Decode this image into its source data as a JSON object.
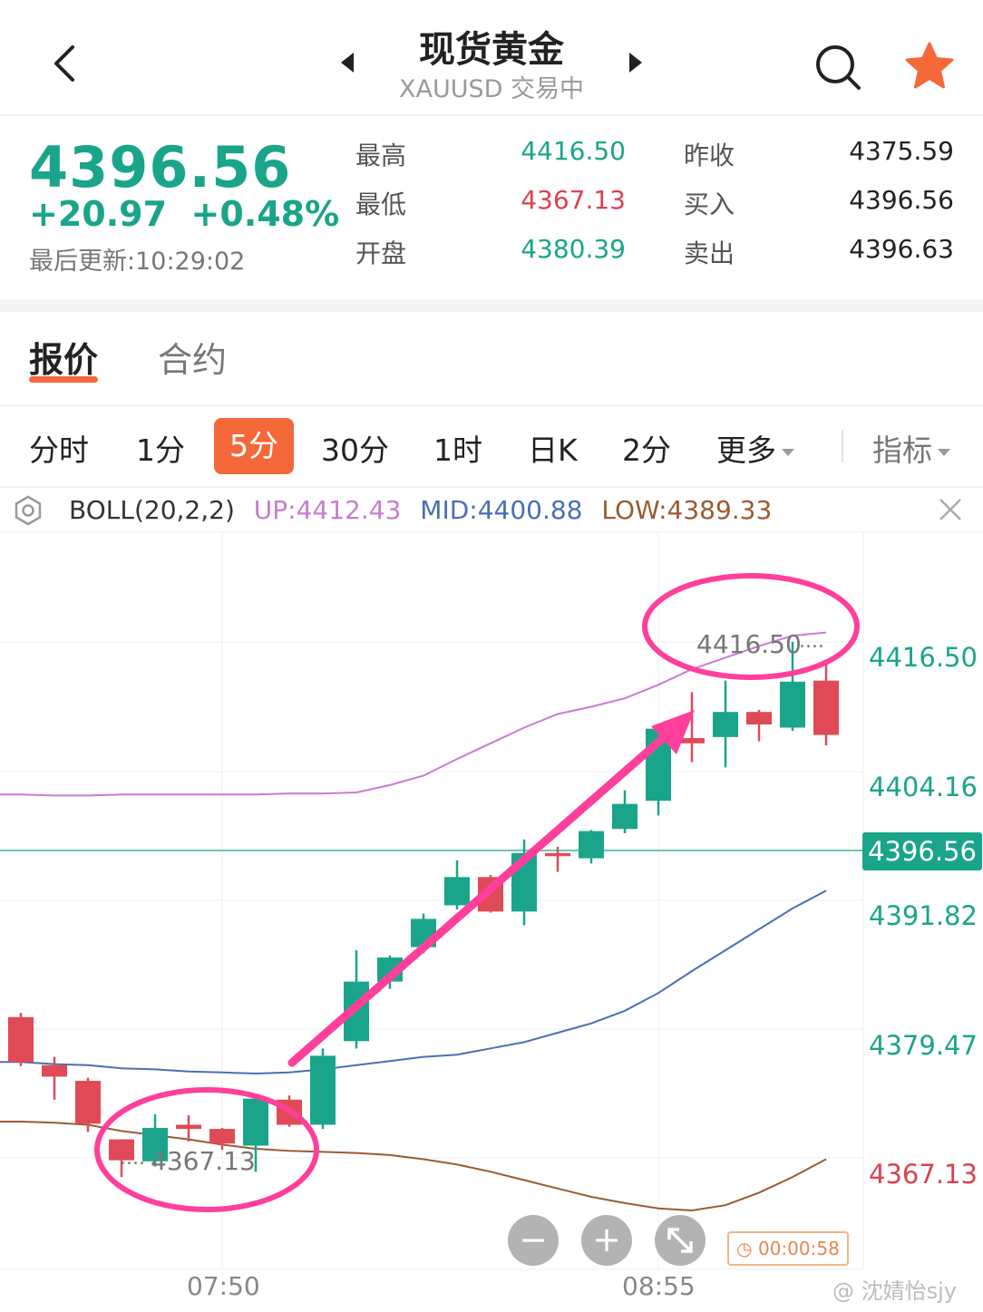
{
  "header": {
    "title": "现货黄金",
    "subtitle": "XAUUSD 交易中",
    "icons": {
      "back": "chevron-left-icon",
      "prev": "triangle-left-icon",
      "next": "triangle-right-icon",
      "search": "search-icon",
      "favorite": "star-icon"
    },
    "favorite_color": "#f5683a"
  },
  "quote": {
    "price": "4396.56",
    "change": "+20.97  +0.48%",
    "updated": "最后更新:10:29:02",
    "stats": [
      {
        "label": "最高",
        "value": "4416.50"
      },
      {
        "label": "最低",
        "value": "4367.13"
      },
      {
        "label": "开盘",
        "value": "4380.39"
      },
      {
        "label": "昨收",
        "value": "4375.59"
      },
      {
        "label": "买入",
        "value": "4396.56"
      },
      {
        "label": "卖出",
        "value": "4396.63"
      }
    ],
    "colors": {
      "up": "#1aa58a",
      "down": "#d9434f"
    }
  },
  "tabs": {
    "active": "报价",
    "other": "合约"
  },
  "intervals": {
    "items": [
      "分时",
      "1分",
      "5分",
      "30分",
      "1时",
      "日K",
      "2分",
      "更多"
    ],
    "active": "5分",
    "indicator_label": "指标"
  },
  "indicator": {
    "name": "BOLL(20,2,2)",
    "up": "UP:4412.43",
    "mid": "MID:4400.88",
    "low": "LOW:4389.33",
    "colors": {
      "up": "#c77dcf",
      "mid": "#4a6fb5",
      "low": "#9a5b33"
    }
  },
  "chart_data": {
    "type": "candlestick",
    "y_labels": [
      "4416.50",
      "4404.16",
      "4391.82",
      "4379.47",
      "4367.13"
    ],
    "current_price": "4396.56",
    "x_labels": [
      "07:50",
      "08:55"
    ],
    "high_annotation": "4416.50",
    "low_annotation": "4367.13",
    "candles": [
      {
        "o": 4380.6,
        "c": 4376.3,
        "h": 4381.0,
        "l": 4375.9
      },
      {
        "o": 4376.0,
        "c": 4374.9,
        "h": 4376.8,
        "l": 4372.7
      },
      {
        "o": 4374.5,
        "c": 4370.4,
        "h": 4374.8,
        "l": 4369.6
      },
      {
        "o": 4368.9,
        "c": 4366.9,
        "h": 4368.9,
        "l": 4365.3
      },
      {
        "o": 4366.8,
        "c": 4370.0,
        "h": 4371.3,
        "l": 4366.3
      },
      {
        "o": 4370.3,
        "c": 4369.9,
        "h": 4371.2,
        "l": 4368.7
      },
      {
        "o": 4369.9,
        "c": 4368.5,
        "h": 4370.0,
        "l": 4367.9
      },
      {
        "o": 4368.3,
        "c": 4372.8,
        "h": 4372.9,
        "l": 4365.8
      },
      {
        "o": 4372.7,
        "c": 4370.3,
        "h": 4373.1,
        "l": 4370.1
      },
      {
        "o": 4370.3,
        "c": 4376.9,
        "h": 4377.6,
        "l": 4369.9
      },
      {
        "o": 4378.3,
        "c": 4384.0,
        "h": 4387.0,
        "l": 4377.6
      },
      {
        "o": 4384.0,
        "c": 4386.3,
        "h": 4386.5,
        "l": 4383.3
      },
      {
        "o": 4387.3,
        "c": 4390.0,
        "h": 4390.5,
        "l": 4386.7
      },
      {
        "o": 4391.3,
        "c": 4394.0,
        "h": 4395.6,
        "l": 4390.9
      },
      {
        "o": 4394.0,
        "c": 4390.7,
        "h": 4394.2,
        "l": 4390.6
      },
      {
        "o": 4390.7,
        "c": 4396.3,
        "h": 4397.6,
        "l": 4389.4
      },
      {
        "o": 4396.3,
        "c": 4396.0,
        "h": 4396.9,
        "l": 4394.5
      },
      {
        "o": 4395.8,
        "c": 4398.4,
        "h": 4398.5,
        "l": 4395.3
      },
      {
        "o": 4398.6,
        "c": 4401.0,
        "h": 4402.3,
        "l": 4398.2
      },
      {
        "o": 4401.3,
        "c": 4408.2,
        "h": 4408.4,
        "l": 4399.9
      },
      {
        "o": 4407.3,
        "c": 4406.8,
        "h": 4411.7,
        "l": 4405.0
      },
      {
        "o": 4407.4,
        "c": 4409.8,
        "h": 4412.8,
        "l": 4404.5
      },
      {
        "o": 4409.8,
        "c": 4408.6,
        "h": 4410.0,
        "l": 4407.0
      },
      {
        "o": 4408.3,
        "c": 4412.7,
        "h": 4416.5,
        "l": 4408.0
      },
      {
        "o": 4412.8,
        "c": 4407.6,
        "h": 4414.8,
        "l": 4406.6
      }
    ],
    "boll_up": [
      4401.9,
      4401.8,
      4401.8,
      4401.9,
      4401.9,
      4401.9,
      4401.9,
      4401.9,
      4402.0,
      4402.0,
      4402.1,
      4402.8,
      4403.7,
      4405.3,
      4406.8,
      4408.3,
      4409.6,
      4410.3,
      4411.1,
      4412.4,
      4413.9,
      4415.0,
      4416.1,
      4417.1,
      4417.4
    ],
    "boll_mid": [
      4376.3,
      4376.1,
      4376.0,
      4375.7,
      4375.6,
      4375.4,
      4375.3,
      4375.2,
      4375.3,
      4375.6,
      4376.0,
      4376.4,
      4376.8,
      4377.0,
      4377.6,
      4378.2,
      4379.1,
      4380.0,
      4381.2,
      4382.9,
      4385.0,
      4387.0,
      4389.0,
      4391.0,
      4392.7
    ],
    "boll_low": [
      4370.6,
      4370.5,
      4370.3,
      4369.7,
      4369.3,
      4368.9,
      4368.4,
      4368.0,
      4367.8,
      4367.7,
      4367.6,
      4367.4,
      4367.0,
      4366.5,
      4365.8,
      4365.0,
      4364.2,
      4363.4,
      4362.8,
      4362.3,
      4362.1,
      4362.6,
      4363.8,
      4365.3,
      4367.0
    ],
    "colors": {
      "up": "#1aa58a",
      "down": "#e04a57",
      "annotation": "#ff3f9b"
    }
  },
  "timer": "00:00:58",
  "watermark": "@ 沈婧怡sjy"
}
